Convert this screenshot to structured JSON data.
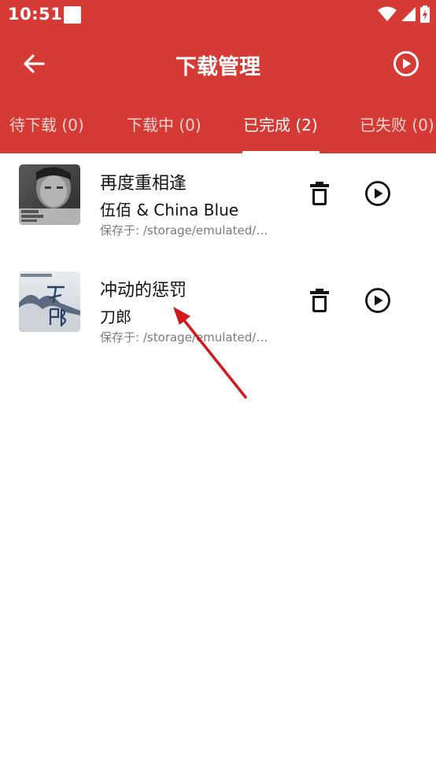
{
  "status_bar": {
    "time": "10:51",
    "icons": [
      "notification-square-icon",
      "wifi-icon",
      "cell-signal-icon",
      "battery-charging-icon"
    ]
  },
  "toolbar": {
    "title": "下载管理",
    "back_icon": "arrow-left-icon",
    "play_all_icon": "play-circle-icon"
  },
  "tabs": [
    {
      "label": "待下载 (0)",
      "active": false
    },
    {
      "label": "下载中 (0)",
      "active": false
    },
    {
      "label": "已完成 (2)",
      "active": true
    },
    {
      "label": "已失败 (0)",
      "active": false
    }
  ],
  "downloads": [
    {
      "title": "再度重相逢",
      "artist": "伍佰 & China Blue",
      "path": "保存于: /storage/emulated/0..."
    },
    {
      "title": "冲动的惩罚",
      "artist": "刀郎",
      "path": "保存于: /storage/emulated/0..."
    }
  ],
  "colors": {
    "header": "#d63a35",
    "annotation_arrow": "#d3191c"
  }
}
